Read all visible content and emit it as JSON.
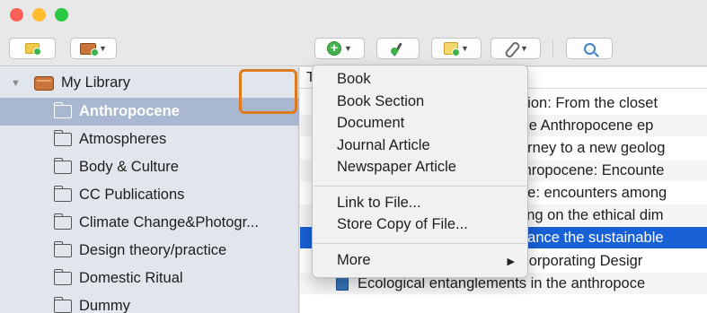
{
  "window": {
    "traffic_lights": [
      "close",
      "minimize",
      "zoom"
    ]
  },
  "toolbar": {
    "buttons": [
      {
        "name": "new-collection",
        "icon": "folder-add-icon"
      },
      {
        "name": "new-library",
        "icon": "library-add-icon"
      },
      {
        "name": "new-item",
        "icon": "plus-circle-icon"
      },
      {
        "name": "add-by-identifier",
        "icon": "magic-wand-icon"
      },
      {
        "name": "new-note",
        "icon": "note-add-icon"
      },
      {
        "name": "add-attachment",
        "icon": "paperclip-icon"
      },
      {
        "name": "advanced-search",
        "icon": "search-icon"
      }
    ]
  },
  "sidebar": {
    "library_label": "My Library",
    "collections": [
      {
        "label": "Anthropocene",
        "selected": true
      },
      {
        "label": "Atmospheres"
      },
      {
        "label": "Body & Culture"
      },
      {
        "label": "CC Publications"
      },
      {
        "label": "Climate Change&Photogr..."
      },
      {
        "label": "Design theory/practice"
      },
      {
        "label": "Domestic Ritual"
      },
      {
        "label": "Dummy"
      }
    ]
  },
  "items": {
    "column_header": "T",
    "rows": [
      {
        "text": "hion: From the closet"
      },
      {
        "text": "the Anthropocene ep"
      },
      {
        "text": "urney to a new geolog"
      },
      {
        "text": "thropocene: Encounte"
      },
      {
        "text": "ne: encounters among"
      },
      {
        "text": "ting on the ethical dim"
      },
      {
        "text": "hance the sustainable",
        "selected": true
      },
      {
        "text": "Designer Ecosystems: Incorporating Desigr"
      },
      {
        "text": "Ecological entanglements in the anthropoce"
      }
    ]
  },
  "menu": {
    "items": [
      "Book",
      "Book Section",
      "Document",
      "Journal Article",
      "Newspaper Article"
    ],
    "file_items": [
      "Link to File...",
      "Store Copy of File..."
    ],
    "more_label": "More",
    "more_arrow": "▶"
  },
  "colors": {
    "sidebar_bg": "#e1e6ec",
    "sidebar_selected": "#aab7d0",
    "item_selected": "#1860d6",
    "highlight_box": "#e07a1f"
  }
}
